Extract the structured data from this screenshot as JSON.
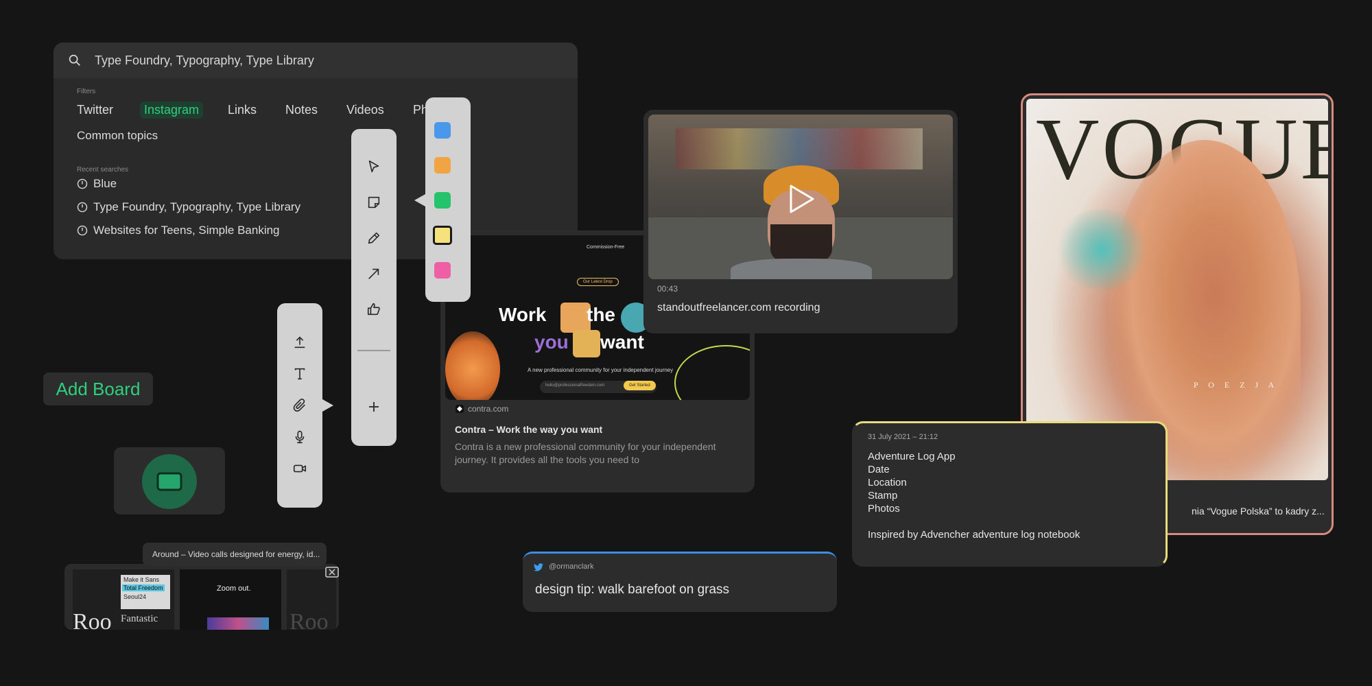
{
  "search": {
    "query": "Type Foundry, Typography, Type Library",
    "filters_label": "Filters",
    "filters": [
      "Twitter",
      "Instagram",
      "Links",
      "Notes",
      "Videos",
      "Ph"
    ],
    "active_filter": "Instagram",
    "common_topics": "Common topics",
    "recent_label": "Recent searches",
    "recent": [
      "Blue",
      "Type Foundry, Typography, Type Library",
      "Websites for Teens, Simple Banking"
    ]
  },
  "tools": {
    "main": [
      "cursor-icon",
      "sticky-note-icon",
      "pencil-icon",
      "arrow-icon",
      "thumbs-up-icon",
      "plus-icon"
    ],
    "insert": [
      "upload-icon",
      "text-icon",
      "paperclip-icon",
      "microphone-icon",
      "video-camera-icon"
    ],
    "colors": [
      "#4a98ec",
      "#f0a443",
      "#25c36b",
      "#f5e27c",
      "#ee5fa6"
    ]
  },
  "video": {
    "duration": "00:43",
    "title": "standoutfreelancer.com recording"
  },
  "contra": {
    "thumb_nav": "Commission-Free",
    "thumb_badge": "Our Latest Drop",
    "thumb_word1": "Work",
    "thumb_word2": "the",
    "thumb_word3": "you",
    "thumb_word4": "want",
    "thumb_sub": "A new professional community for your independent journey",
    "thumb_email": "hello@professionalfreedom.com",
    "thumb_cta": "Get Started",
    "domain": "contra.com",
    "title": "Contra – Work the way you want",
    "desc": "Contra is a new professional community for your independent journey. It provides all the tools you need to"
  },
  "vogue": {
    "masthead": "VOGUE",
    "poezja": "P O E Z J A",
    "caption": "nia “Vogue Polska” to kadry z..."
  },
  "note": {
    "timestamp": "31 July 2021 – 21:12",
    "lines": [
      "Adventure Log App",
      "Date",
      "Location",
      "Stamp",
      "Photos"
    ],
    "footer": "Inspired by Advencher adventure log notebook"
  },
  "tweet": {
    "handle": "@ormanclark",
    "text": "design tip: walk barefoot on grass"
  },
  "add_board": "Add Board",
  "around": {
    "tooltip": "Around – Video calls designed for energy, id...",
    "thumb1_text": "Make it Sans",
    "thumb1_highlight": "Total Freedom",
    "thumb1_sub": "Seoul24",
    "thumb1_bottom": "Fantastic",
    "thumb2_title": "Zoom out.",
    "big_letters": "Roo"
  }
}
